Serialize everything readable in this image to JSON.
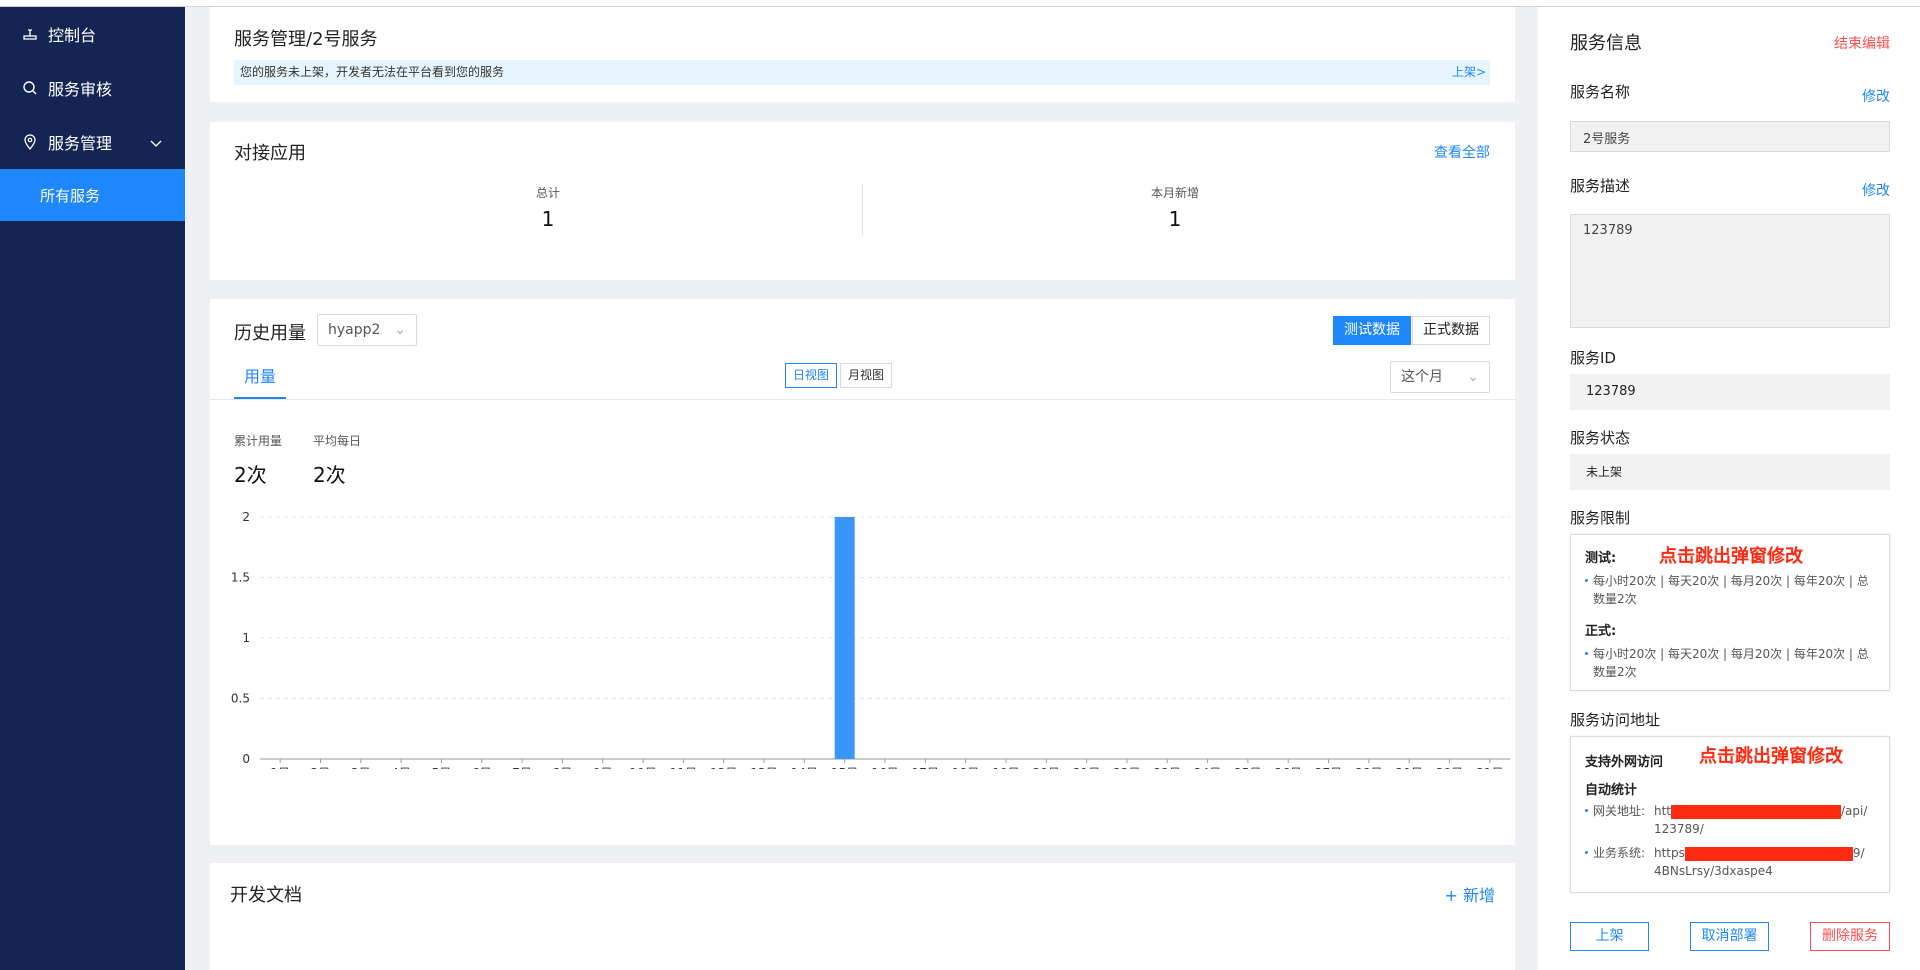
{
  "sidebar": {
    "items": [
      {
        "label": "控制台",
        "icon": "dashboard-icon"
      },
      {
        "label": "服务审核",
        "icon": "search-icon"
      },
      {
        "label": "服务管理",
        "icon": "location-icon"
      }
    ],
    "sub_item": "所有服务"
  },
  "header": {
    "breadcrumb": "服务管理/2号服务",
    "notice": "您的服务未上架，开发者无法在平台看到您的服务",
    "notice_link": "上架>"
  },
  "apps": {
    "title": "对接应用",
    "view_all": "查看全部",
    "total_label": "总计",
    "total_value": "1",
    "month_label": "本月新增",
    "month_value": "1"
  },
  "history": {
    "title": "历史用量",
    "app_select": "hyapp2",
    "test_data": "测试数据",
    "prod_data": "正式数据",
    "tab": "用量",
    "day_view": "日视图",
    "month_view": "月视图",
    "period_select": "这个月",
    "cumulative_label": "累计用量",
    "cumulative_value": "2次",
    "daily_avg_label": "平均每日",
    "daily_avg_value": "2次"
  },
  "chart_data": {
    "type": "bar",
    "categories": [
      "1日",
      "2日",
      "3日",
      "4日",
      "5日",
      "6日",
      "7日",
      "8日",
      "9日",
      "10日",
      "11日",
      "12日",
      "13日",
      "14日",
      "15日",
      "16日",
      "17日",
      "18日",
      "19日",
      "20日",
      "21日",
      "22日",
      "23日",
      "24日",
      "25日",
      "26日",
      "27日",
      "28日",
      "29日",
      "30日",
      "31日"
    ],
    "values": [
      0,
      0,
      0,
      0,
      0,
      0,
      0,
      0,
      0,
      0,
      0,
      0,
      0,
      0,
      2,
      0,
      0,
      0,
      0,
      0,
      0,
      0,
      0,
      0,
      0,
      0,
      0,
      0,
      0,
      0,
      0
    ],
    "yticks": [
      "0",
      "0.5",
      "1",
      "1.5",
      "2"
    ],
    "ylim": [
      0,
      2
    ],
    "bar_color": "#3a96fa",
    "grid": true
  },
  "docs": {
    "title": "开发文档",
    "add": "+ 新增"
  },
  "info": {
    "title": "服务信息",
    "end_edit": "结束编辑",
    "name_label": "服务名称",
    "edit": "修改",
    "name_value": "2号服务",
    "desc_label": "服务描述",
    "desc_value": "123789",
    "id_label": "服务ID",
    "id_value": "123789",
    "status_label": "服务状态",
    "status_value": "未上架",
    "limit_label": "服务限制",
    "test_label": "测试:",
    "test_limit": "每小时20次 | 每天20次 | 每月20次 | 每年20次 | 总数量2次",
    "prod_label": "正式:",
    "prod_limit": "每小时20次 | 每天20次 | 每月20次 | 每年20次 | 总数量2次",
    "popup_note": "点击跳出弹窗修改",
    "addr_label": "服务访问地址",
    "external": "支持外网访问",
    "auto_stats": "自动统计",
    "gateway_label": "网关地址:",
    "gateway_prefix": "htt",
    "gateway_suffix": "/api/123789/",
    "biz_label": "业务系统:",
    "biz_prefix": "https",
    "biz_suffix": "9/4BNsLrsy/3dxaspe4",
    "btn_publish": "上架",
    "btn_undeploy": "取消部署",
    "btn_delete": "删除服务"
  }
}
